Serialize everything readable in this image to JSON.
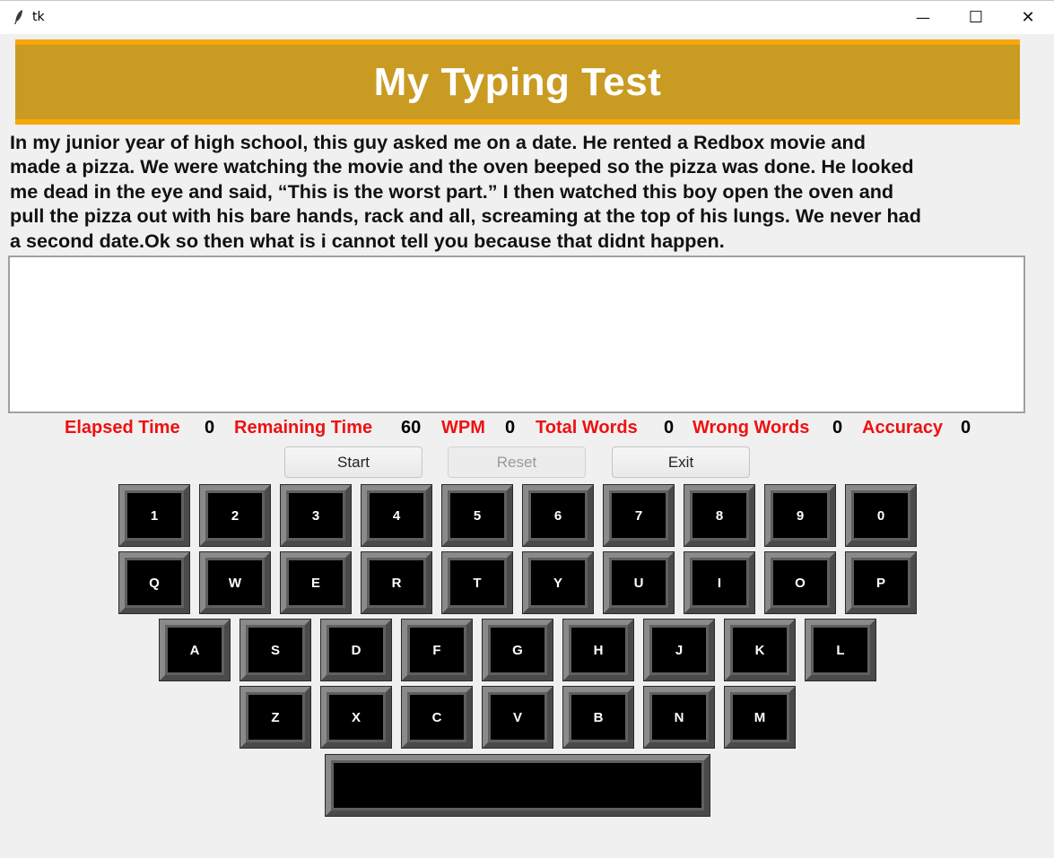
{
  "window": {
    "title": "tk",
    "minimize_glyph": "—",
    "maximize_glyph": "☐",
    "close_glyph": "✕"
  },
  "header": {
    "title": "My Typing Test",
    "background_color": "#c99b22",
    "border_color": "#f9a60a"
  },
  "passage": {
    "lines": [
      " In my junior year of high school, this guy asked me on a date. He rented a Redbox movie and",
      "made a pizza. We were watching the movie and the oven beeped so the pizza was done. He looked",
      "me dead in the eye and said, “This is the worst part.” I then watched this boy open the oven and",
      "pull the pizza out with his bare hands, rack and all, screaming at the top of his lungs. We never had",
      "a second date.Ok so then what is i cannot tell you because that didnt happen."
    ]
  },
  "entry": {
    "value": ""
  },
  "stats": {
    "label_color": "#ee1111",
    "elapsed_label": "Elapsed Time",
    "elapsed_value": "0",
    "remaining_label": "Remaining Time",
    "remaining_value": "60",
    "wpm_label": "WPM",
    "wpm_value": "0",
    "total_label": "Total Words",
    "total_value": "0",
    "wrong_label": "Wrong Words",
    "wrong_value": "0",
    "accuracy_label": "Accuracy",
    "accuracy_value": "0"
  },
  "buttons": {
    "start": "Start",
    "reset": "Reset",
    "reset_disabled": true,
    "exit": "Exit"
  },
  "keyboard": {
    "rows": [
      [
        "1",
        "2",
        "3",
        "4",
        "5",
        "6",
        "7",
        "8",
        "9",
        "0"
      ],
      [
        "Q",
        "W",
        "E",
        "R",
        "T",
        "Y",
        "U",
        "I",
        "O",
        "P"
      ],
      [
        "A",
        "S",
        "D",
        "F",
        "G",
        "H",
        "J",
        "K",
        "L"
      ],
      [
        "Z",
        "X",
        "C",
        "V",
        "B",
        "N",
        "M"
      ]
    ],
    "space_label": ""
  }
}
